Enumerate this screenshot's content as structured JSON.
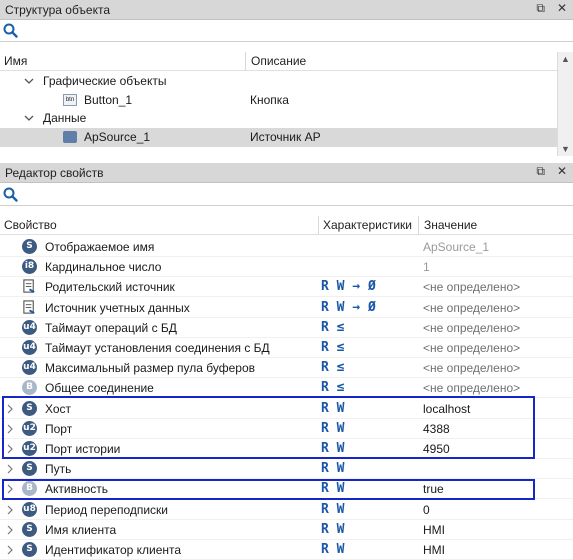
{
  "structure_panel": {
    "title": "Структура объекта",
    "columns": [
      "Имя",
      "Описание"
    ],
    "tree": [
      {
        "name": "Графические объекты",
        "description": "",
        "level": 1,
        "expanded": true,
        "icon": "folder",
        "selected": false
      },
      {
        "name": "Button_1",
        "description": "Кнопка",
        "level": 2,
        "expanded": null,
        "icon": "button-icon",
        "selected": false
      },
      {
        "name": "Данные",
        "description": "",
        "level": 1,
        "expanded": true,
        "icon": "folder",
        "selected": false
      },
      {
        "name": "ApSource_1",
        "description": "Источник АР",
        "level": 2,
        "expanded": null,
        "icon": "source-icon",
        "selected": true
      }
    ]
  },
  "properties_panel": {
    "title": "Редактор свойств",
    "columns": [
      "Свойство",
      "Характеристики",
      "Значение"
    ],
    "rows": [
      {
        "badge": "S",
        "badge_style": "dark",
        "name": "Отображаемое имя",
        "chars": "",
        "value": "ApSource_1",
        "value_style": "muted",
        "expandable": false
      },
      {
        "badge": "i8",
        "badge_style": "dark",
        "name": "Кардинальное число",
        "chars": "",
        "value": "1",
        "value_style": "muted",
        "expandable": false
      },
      {
        "badge": "link",
        "badge_style": "icon",
        "name": "Родительский источник",
        "chars": "R W → Ø",
        "value": "<не определено>",
        "value_style": "undef",
        "expandable": false
      },
      {
        "badge": "link",
        "badge_style": "icon",
        "name": "Источник учетных данных",
        "chars": "R W → Ø",
        "value": "<не определено>",
        "value_style": "undef",
        "expandable": false
      },
      {
        "badge": "u4",
        "badge_style": "dark",
        "name": "Таймаут операций с БД",
        "chars": "R ≤",
        "value": "<не определено>",
        "value_style": "undef",
        "expandable": false
      },
      {
        "badge": "u4",
        "badge_style": "dark",
        "name": "Таймаут установления соединения с БД",
        "chars": "R ≤",
        "value": "<не определено>",
        "value_style": "undef",
        "expandable": false
      },
      {
        "badge": "u4",
        "badge_style": "dark",
        "name": "Максимальный размер пула буферов",
        "chars": "R ≤",
        "value": "<не определено>",
        "value_style": "undef",
        "expandable": false
      },
      {
        "badge": "B",
        "badge_style": "grey",
        "name": "Общее соединение",
        "chars": "R ≤",
        "value": "<не определено>",
        "value_style": "undef",
        "expandable": false
      },
      {
        "badge": "S",
        "badge_style": "dark",
        "name": "Хост",
        "chars": "R W",
        "value": "localhost",
        "value_style": "normal",
        "expandable": true
      },
      {
        "badge": "u2",
        "badge_style": "dark",
        "name": "Порт",
        "chars": "R W",
        "value": "4388",
        "value_style": "normal",
        "expandable": true
      },
      {
        "badge": "u2",
        "badge_style": "dark",
        "name": "Порт истории",
        "chars": "R W",
        "value": "4950",
        "value_style": "normal",
        "expandable": true
      },
      {
        "badge": "S",
        "badge_style": "dark",
        "name": "Путь",
        "chars": "R W",
        "value": "",
        "value_style": "normal",
        "expandable": true
      },
      {
        "badge": "B",
        "badge_style": "grey",
        "name": "Активность",
        "chars": "R W",
        "value": "true",
        "value_style": "normal",
        "expandable": true
      },
      {
        "badge": "u8",
        "badge_style": "dark",
        "name": "Период переподписки",
        "chars": "R W",
        "value": "0",
        "value_style": "normal",
        "expandable": true
      },
      {
        "badge": "S",
        "badge_style": "dark",
        "name": "Имя клиента",
        "chars": "R W",
        "value": "HMI",
        "value_style": "normal",
        "expandable": true
      },
      {
        "badge": "S",
        "badge_style": "dark",
        "name": "Идентификатор клиента",
        "chars": "R W",
        "value": "HMI",
        "value_style": "normal",
        "expandable": true
      }
    ]
  },
  "colors": {
    "highlight_border": "#1626c8",
    "access_letters": "#1a57a8",
    "selected_row": "#d9d9d9"
  }
}
